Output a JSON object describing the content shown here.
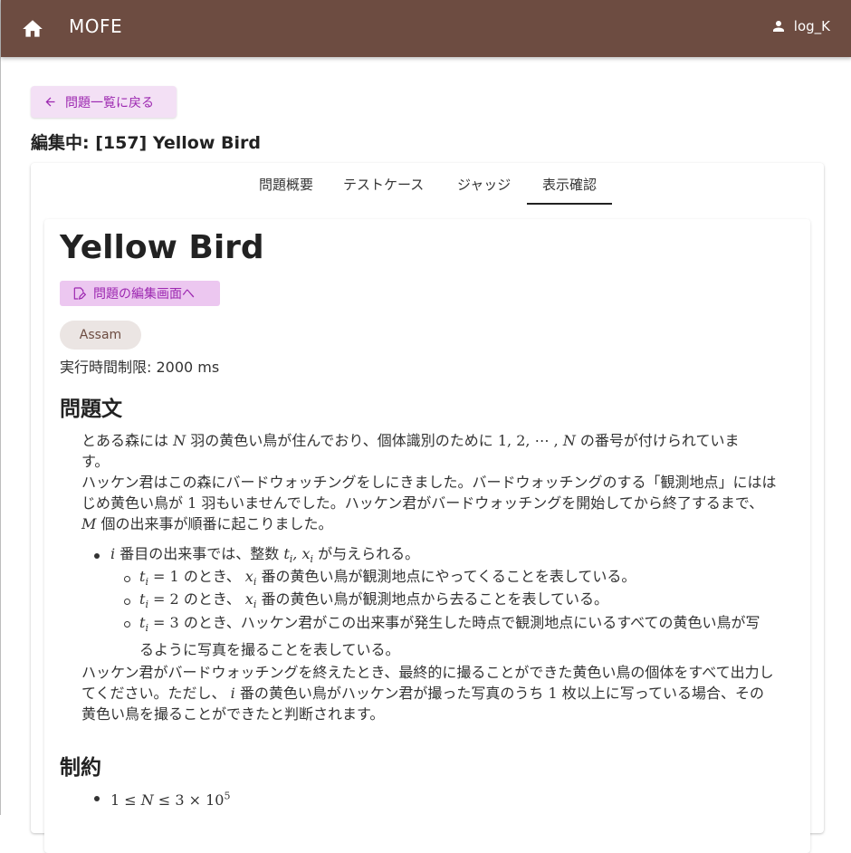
{
  "appbar": {
    "title": "MOFE",
    "user": "log_K"
  },
  "back_button": "問題一覧に戻る",
  "editing_heading": "編集中: [157] Yellow Bird",
  "tabs": [
    "問題概要",
    "テストケース",
    "ジャッジ",
    "表示確認"
  ],
  "active_tab": "表示確認",
  "problem": {
    "title": "Yellow Bird",
    "edit_button": "問題の編集画面へ",
    "difficulty_chip": "Assam",
    "time_limit": "実行時間制限: 2000 ms",
    "statement_heading": "問題文",
    "statement": {
      "p1a": "とある森には",
      "p1b": "羽の黄色い鳥が住んでおり、個体識別のために",
      "p1c": "の番号が付けられていま",
      "p1d": "す。",
      "p2a": "ハッケン君はこの森にバードウォッチングをしにきました。バードウォッチングのする「観測地点」にはは",
      "p2b": "じめ黄色い鳥が",
      "p2c": "羽もいませんでした。ハッケン君がバードウォッチングを開始してから終了するまで、",
      "p2d": "個の出来事が順番に起こりました。",
      "b1a": "番目の出来事では、整数",
      "b1b": "が与えられる。",
      "s1": "のとき、",
      "s1b": "番の黄色い鳥が観測地点にやってくることを表している。",
      "s2": "のとき、",
      "s2b": "番の黄色い鳥が観測地点から去ることを表している。",
      "s3a": "のとき、ハッケン君がこの出来事が発生した時点で観測地点にいるすべての黄色い鳥が写",
      "s3b": "るように写真を撮ることを表している。",
      "p3a": "ハッケン君がバードウォッチングを終えたとき、最終的に撮ることができた黄色い鳥の個体をすべて出力し",
      "p3b": "てください。ただし、",
      "p3c": "番の黄色い鳥がハッケン君が撮った写真のうち",
      "p3d": "枚以上に写っている場合、その",
      "p3e": "黄色い鳥を撮ることができたと判断されます。"
    },
    "constraints_heading": "制約"
  },
  "colors": {
    "appbar": "#6d4c41",
    "accent": "#9c27b0"
  }
}
